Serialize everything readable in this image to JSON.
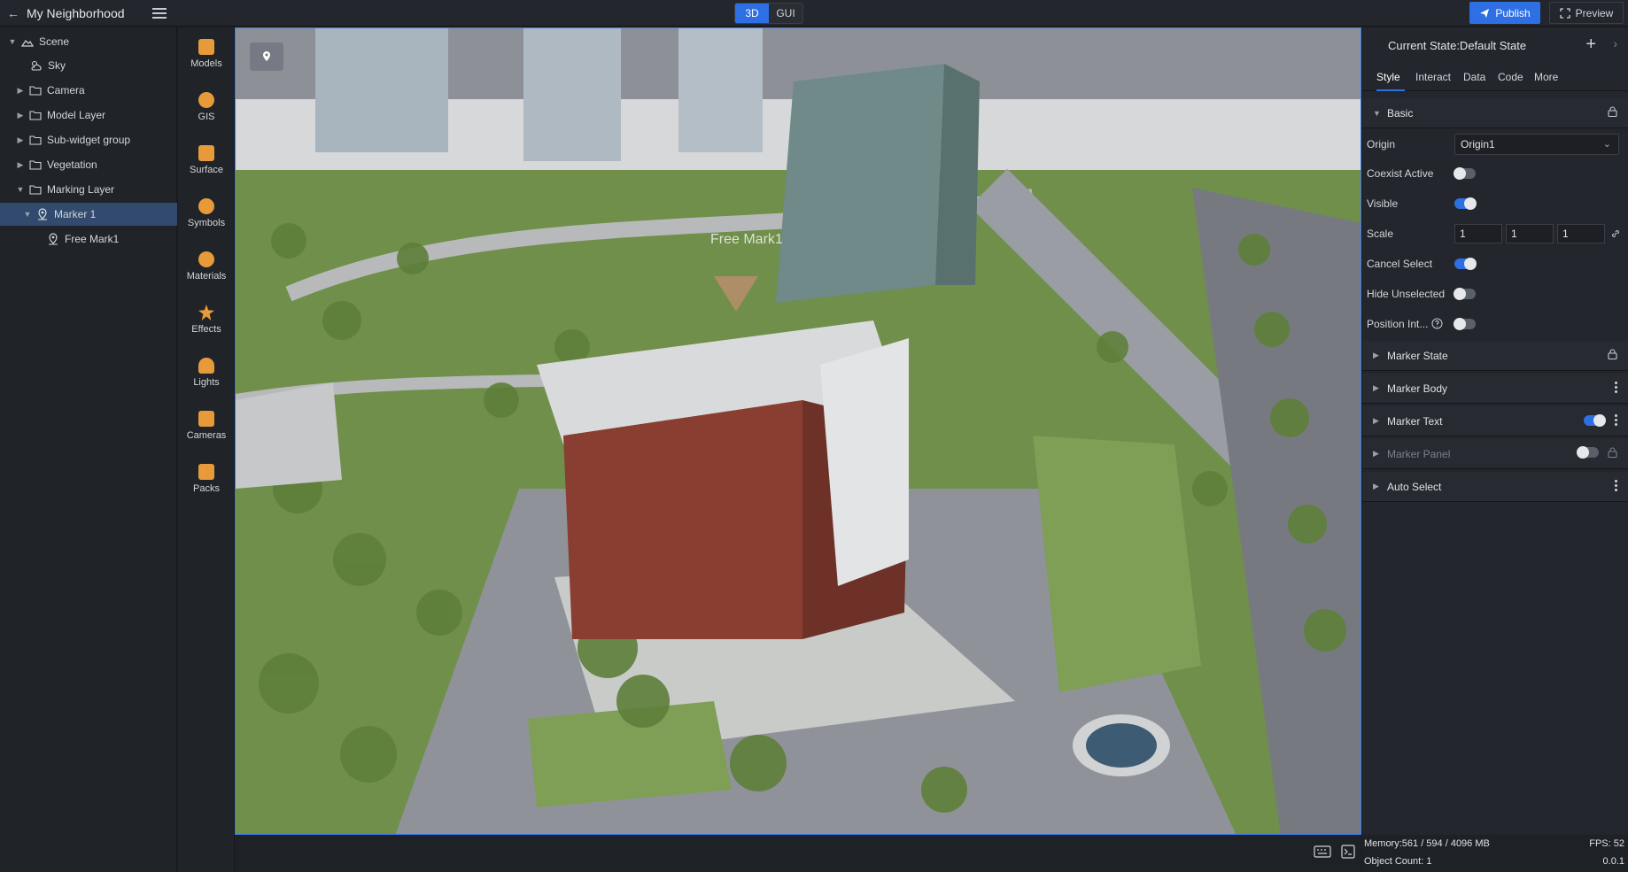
{
  "project": {
    "title": "My Neighborhood"
  },
  "view_toggle": {
    "mode_3d": "3D",
    "mode_gui": "GUI"
  },
  "actions": {
    "publish": "Publish",
    "preview": "Preview"
  },
  "tree": {
    "items": [
      {
        "label": "Scene",
        "icon": "landscape-icon",
        "expanded": true
      },
      {
        "label": "Sky",
        "icon": "cloud-sun-icon"
      },
      {
        "label": "Camera",
        "icon": "folder-icon"
      },
      {
        "label": "Model Layer",
        "icon": "folder-icon"
      },
      {
        "label": "Sub-widget group",
        "icon": "folder-icon"
      },
      {
        "label": "Vegetation",
        "icon": "folder-icon"
      },
      {
        "label": "Marking Layer",
        "icon": "folder-icon",
        "expanded": true
      },
      {
        "label": "Marker 1",
        "icon": "marker-icon",
        "selected": true
      },
      {
        "label": "Free Mark1",
        "icon": "marker-icon"
      }
    ]
  },
  "widgets": [
    {
      "label": "Models",
      "icon": "models-icon"
    },
    {
      "label": "GIS",
      "icon": "globe-icon"
    },
    {
      "label": "Surface",
      "icon": "surface-icon"
    },
    {
      "label": "Symbols",
      "icon": "symbols-icon"
    },
    {
      "label": "Materials",
      "icon": "materials-icon"
    },
    {
      "label": "Effects",
      "icon": "effects-icon"
    },
    {
      "label": "Lights",
      "icon": "lights-icon"
    },
    {
      "label": "Cameras",
      "icon": "camera-icon"
    },
    {
      "label": "Packs",
      "icon": "packs-icon"
    }
  ],
  "viewport": {
    "marker_label": "Free Mark1"
  },
  "props": {
    "state_title": "Current State:Default State",
    "tabs": [
      "Style",
      "Interact",
      "Data",
      "Code",
      "More"
    ],
    "active_tab": "Style",
    "basic": {
      "title": "Basic",
      "origin_label": "Origin",
      "origin_value": "Origin1",
      "coexist_label": "Coexist Active",
      "coexist_on": false,
      "visible_label": "Visible",
      "visible_on": true,
      "scale_label": "Scale",
      "scale_x": "1",
      "scale_y": "1",
      "scale_z": "1",
      "cancel_select_label": "Cancel Select",
      "cancel_select_on": true,
      "hide_unselected_label": "Hide Unselected",
      "hide_unselected_on": false,
      "position_int_label": "Position Int...",
      "position_int_on": false
    },
    "sections": {
      "marker_state": "Marker State",
      "marker_body": "Marker Body",
      "marker_text": "Marker Text",
      "marker_panel": "Marker Panel",
      "auto_select": "Auto Select"
    }
  },
  "status": {
    "memory": "Memory:561 / 594 / 4096 MB",
    "object_count": "Object Count: 1",
    "fps": "FPS: 52",
    "version": "0.0.1"
  },
  "colors": {
    "accent": "#2f6fe4",
    "panel": "#23262c",
    "selected": "#324a6e",
    "widget_icon": "#e79a3a"
  }
}
